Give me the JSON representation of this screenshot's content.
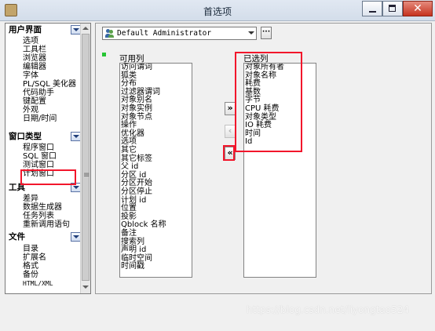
{
  "window": {
    "title": "首选项",
    "minimize_label": "–",
    "maximize_label": "□",
    "close_label": "✕"
  },
  "categories": {
    "groups": [
      {
        "label": "用户界面",
        "items": [
          "选项",
          "工具栏",
          "浏览器",
          "编辑器",
          "字体",
          "PL/SQL 美化器",
          "代码助手",
          "键配置",
          "外观",
          "日期/时间"
        ]
      },
      {
        "label": "窗口类型",
        "items": [
          "程序窗口",
          "SQL 窗口",
          "测试窗口",
          "计划窗口"
        ]
      },
      {
        "label": "工具",
        "items": [
          "差异",
          "数据生成器",
          "任务列表",
          "重新调用语句"
        ]
      },
      {
        "label": "文件",
        "items": [
          "目录",
          "扩展名",
          "格式",
          "备份",
          "HTML/XML"
        ]
      }
    ]
  },
  "main": {
    "profile": "Default Administrator",
    "more_button": "···",
    "available_label": "可用列",
    "selected_label": "已选列",
    "available": [
      "访问谓词",
      "狐类",
      "分布",
      "过滤器谓词",
      "对象别名",
      "对象实例",
      "对象节点",
      "操作",
      "优化器",
      "选项",
      "其它",
      "其它标签",
      "父 id",
      "分区 id",
      "分区开始",
      "分区停止",
      "计划 id",
      "位置",
      "投影",
      "Qblock 名称",
      "备注",
      "搜索列",
      "声明 id",
      "临时空间",
      "时间戳"
    ],
    "selected": [
      "对象所有者",
      "对象名称",
      "耗费",
      "基数",
      "字节",
      "CPU 耗费",
      "对象类型",
      "IO 耗费",
      "时间",
      "Id"
    ],
    "btn_add": "»",
    "btn_remove": "‹",
    "btn_remove_all": "«"
  },
  "watermark": "https://blog.csdn.net/liyongtao524",
  "colors": {
    "annotation_red": "#f2162b",
    "indicator_green": "#27c534"
  }
}
